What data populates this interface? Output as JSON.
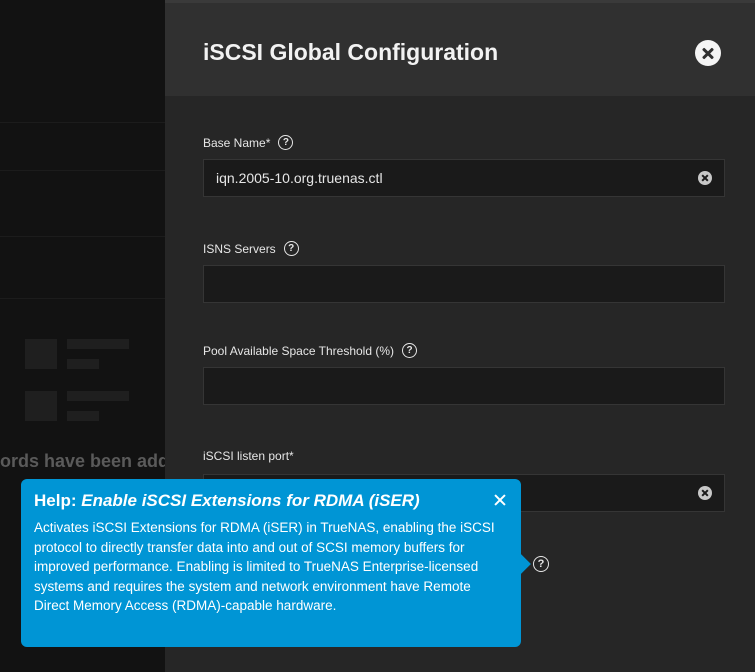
{
  "background": {
    "records_text": "ords have been adde"
  },
  "panel": {
    "title": "iSCSI Global Configuration",
    "fields": {
      "base_name": {
        "label": "Base Name",
        "required_mark": "*",
        "value": "iqn.2005-10.org.truenas.ctl"
      },
      "isns_servers": {
        "label": "ISNS Servers",
        "value": ""
      },
      "pool_threshold": {
        "label": "Pool Available Space Threshold (%)",
        "value": ""
      },
      "listen_port": {
        "label": "iSCSI listen port",
        "required_mark": "*",
        "value": ""
      }
    }
  },
  "tooltip": {
    "prefix": "Help: ",
    "title": "Enable iSCSI Extensions for RDMA (iSER)",
    "body": "Activates iSCSI Extensions for RDMA (iSER) in TrueNAS, enabling the iSCSI protocol to directly transfer data into and out of SCSI memory buffers for improved performance. Enabling is limited to TrueNAS Enterprise-licensed systems and requires the system and network environment have Remote Direct Memory Access (RDMA)-capable hardware."
  },
  "icons": {
    "help": "?",
    "close": "close-icon",
    "clear": "clear-icon"
  },
  "colors": {
    "tooltip_bg": "#0095d5",
    "panel_bg": "#262626",
    "header_bg": "#303030"
  }
}
